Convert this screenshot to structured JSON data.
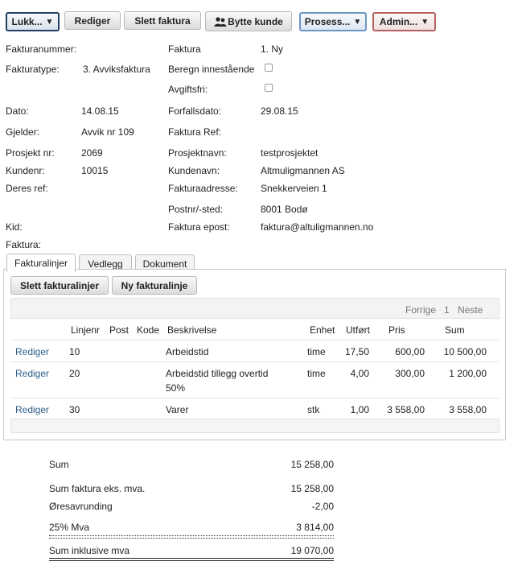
{
  "toolbar": {
    "lukk": "Lukk...",
    "rediger": "Rediger",
    "slett_faktura": "Slett faktura",
    "bytte_kunde": "Bytte kunde",
    "prosess": "Prosess...",
    "admin": "Admin...",
    "caret": "▼"
  },
  "header": {
    "fakturanummer_label": "Fakturanummer:",
    "faktura_label": "Faktura",
    "faktura_value": "1. Ny",
    "fakturatype_label": "Fakturatype:",
    "fakturatype_value": "3. Avviksfaktura",
    "beregn_label": "Beregn innestående",
    "avgiftsfri_label": "Avgiftsfri:",
    "dato_label": "Dato:",
    "dato_value": "14.08.15",
    "forfallsdato_label": "Forfallsdato:",
    "forfallsdato_value": "29.08.15",
    "gjelder_label": "Gjelder:",
    "gjelder_value": "Avvik nr 109",
    "faktura_ref_label": "Faktura Ref:",
    "prosjekt_nr_label": "Prosjekt nr:",
    "prosjekt_nr_value": "2069",
    "prosjektnavn_label": "Prosjektnavn:",
    "prosjektnavn_value": "testprosjektet",
    "kundenr_label": "Kundenr:",
    "kundenr_value": "10015",
    "kundenavn_label": "Kundenavn:",
    "kundenavn_value": "Altmuligmannen AS",
    "deres_ref_label": "Deres ref:",
    "fakturaadresse_label": "Fakturaadresse:",
    "fakturaadresse_value": "Snekkerveien 1",
    "postnr_label": "Postnr/-sted:",
    "postnr_value": "8001 Bodø",
    "kid_label": "Kid:",
    "faktura_epost_label": "Faktura epost:",
    "faktura_epost_value": "faktura@altuligmannen.no",
    "faktura2_label": "Faktura:"
  },
  "tabs": [
    {
      "label": "Fakturalinjer"
    },
    {
      "label": "Vedlegg"
    },
    {
      "label": "Dokument"
    }
  ],
  "lines_panel": {
    "slett_btn": "Slett fakturalinjer",
    "ny_btn": "Ny fakturalinje",
    "pager": {
      "prev": "Forrige",
      "page": "1",
      "next": "Neste"
    },
    "columns": [
      "Linjenr",
      "Post",
      "Kode",
      "Beskrivelse",
      "Enhet",
      "Utført",
      "Pris",
      "Sum"
    ],
    "rows": [
      {
        "action": "Rediger",
        "linjenr": "10",
        "beskrivelse1": "Arbeidstid",
        "beskrivelse2": "",
        "enhet": "time",
        "utfort": "17,50",
        "pris": "600,00",
        "sum": "10 500,00"
      },
      {
        "action": "Rediger",
        "linjenr": "20",
        "beskrivelse1": "Arbeidstid tillegg overtid",
        "beskrivelse2": "50%",
        "enhet": "time",
        "utfort": "4,00",
        "pris": "300,00",
        "sum": "1 200,00"
      },
      {
        "action": "Rediger",
        "linjenr": "30",
        "beskrivelse1": "Varer",
        "beskrivelse2": "",
        "enhet": "stk",
        "utfort": "1,00",
        "pris": "3 558,00",
        "sum": "3 558,00"
      }
    ]
  },
  "summary": {
    "sum_label": "Sum",
    "sum_value": "15 258,00",
    "eks_label": "Sum faktura eks. mva.",
    "eks_value": "15 258,00",
    "avrunding_label": "Øresavrunding",
    "avrunding_value": "-2,00",
    "mva_label": "25% Mva",
    "mva_value": "3 814,00",
    "inkl_label": "Sum inklusive mva",
    "inkl_value": "19 070,00"
  }
}
